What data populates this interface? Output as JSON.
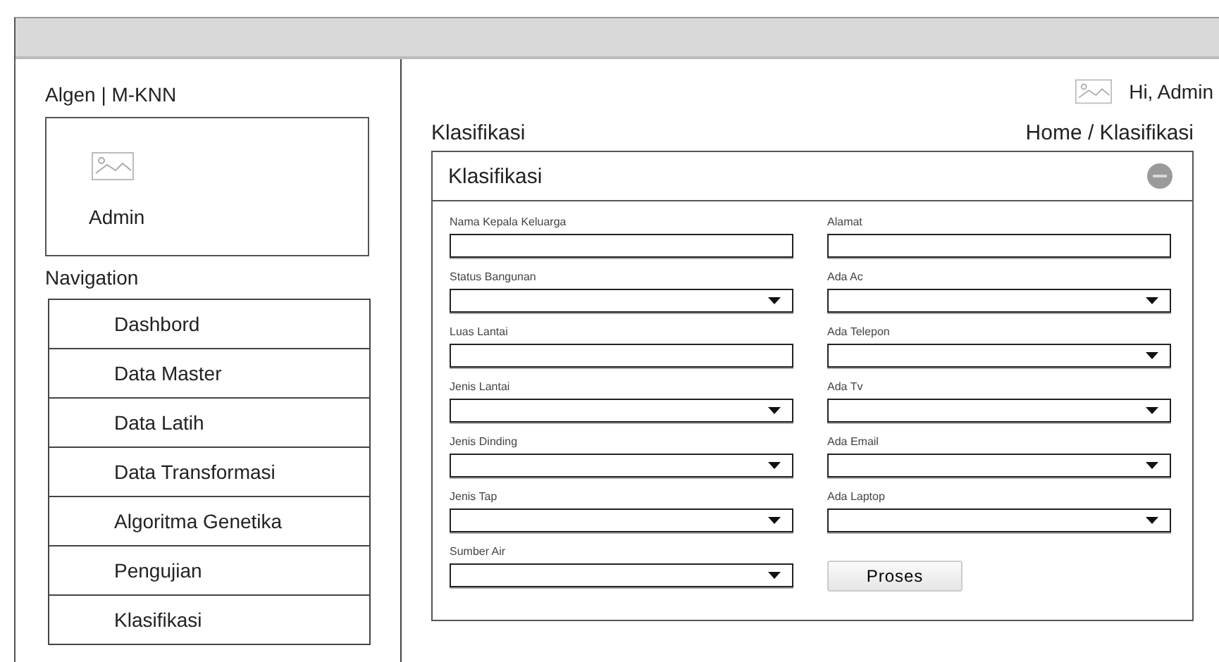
{
  "sidebar": {
    "brand": "Algen | M-KNN",
    "profile": {
      "name": "Admin"
    },
    "nav_heading": "Navigation",
    "items": [
      {
        "label": "Dashbord"
      },
      {
        "label": "Data Master"
      },
      {
        "label": "Data Latih"
      },
      {
        "label": "Data Transformasi"
      },
      {
        "label": "Algoritma Genetika"
      },
      {
        "label": "Pengujian"
      },
      {
        "label": "Klasifikasi"
      }
    ]
  },
  "header": {
    "greeting": "Hi, Admin"
  },
  "page": {
    "title": "Klasifikasi",
    "breadcrumb": "Home / Klasifikasi"
  },
  "panel": {
    "title": "Klasifikasi",
    "left_fields": [
      {
        "label": "Nama Kepala Keluarga",
        "kind": "text"
      },
      {
        "label": "Status Bangunan",
        "kind": "select"
      },
      {
        "label": "Luas Lantai",
        "kind": "text"
      },
      {
        "label": "Jenis Lantai",
        "kind": "select"
      },
      {
        "label": "Jenis Dinding",
        "kind": "select"
      },
      {
        "label": "Jenis Tap",
        "kind": "select"
      },
      {
        "label": "Sumber Air",
        "kind": "select"
      }
    ],
    "right_fields": [
      {
        "label": "Alamat",
        "kind": "text"
      },
      {
        "label": "Ada Ac",
        "kind": "select"
      },
      {
        "label": "Ada Telepon",
        "kind": "select"
      },
      {
        "label": "Ada Tv",
        "kind": "select"
      },
      {
        "label": "Ada Email",
        "kind": "select"
      },
      {
        "label": "Ada Laptop",
        "kind": "select"
      }
    ],
    "button": "Proses"
  }
}
